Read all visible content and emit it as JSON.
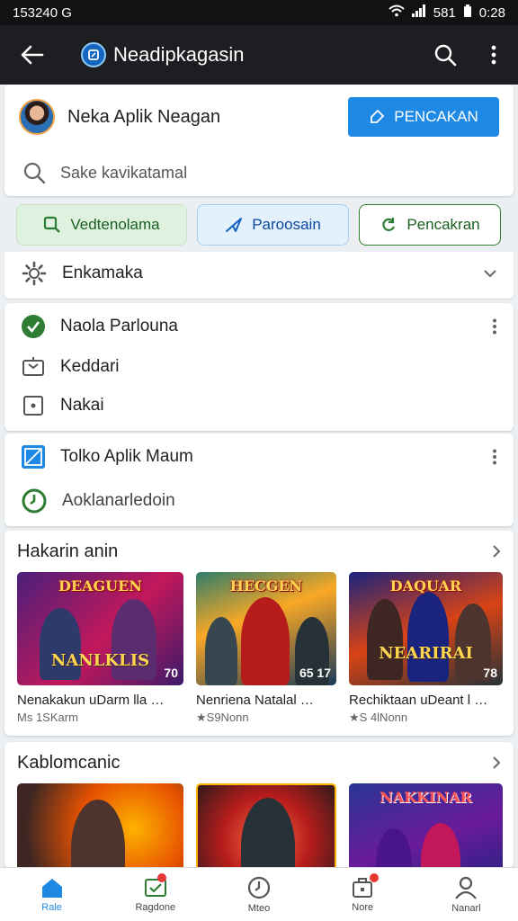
{
  "status_bar": {
    "time_left": "153240 G",
    "clock": "0:28",
    "signal_text": "581"
  },
  "app_bar": {
    "title": "Neadipkagasin"
  },
  "profile": {
    "name": "Neka Aplik Neagan",
    "action_label": "PENCAKAN"
  },
  "search": {
    "placeholder": "Sake kavikatamal"
  },
  "chips": [
    {
      "label": "Vedtenolama"
    },
    {
      "label": "Paroosain"
    },
    {
      "label": "Pencakran"
    }
  ],
  "settings_row": {
    "label": "Enkamaka"
  },
  "list1": [
    {
      "label": "Naola Parlouna"
    },
    {
      "label": "Keddari"
    },
    {
      "label": "Nakai"
    }
  ],
  "list2": [
    {
      "label": "Tolko Aplik Maum"
    },
    {
      "label": "Aoklanarledoin"
    }
  ],
  "section1": {
    "title": "Hakarin anin",
    "items": [
      {
        "art_top": "DEAGUEN",
        "art_bottom": "NANLKLIS",
        "num": "70",
        "title": "Nenakakun uDarm lla",
        "sub": "Ms 1SKarm"
      },
      {
        "art_top": "HECGEN",
        "art_bottom": "",
        "num": "65 17",
        "title": "Nenriena Natalal",
        "sub": "S9Nonn"
      },
      {
        "art_top": "DAQUAR",
        "art_bottom": "NEARIRAI",
        "num": "78",
        "title": "Rechiktaan uDeant l",
        "sub": "S 4lNonn"
      }
    ]
  },
  "section2": {
    "title": "Kablomcanic",
    "items": [
      {
        "art_top": ""
      },
      {
        "art_top": ""
      },
      {
        "art_top": "NAKKINAR"
      }
    ]
  },
  "bottom_nav": [
    {
      "label": "Rale"
    },
    {
      "label": "Ragdone"
    },
    {
      "label": "Mteo"
    },
    {
      "label": "Nore"
    },
    {
      "label": "Nanarl"
    }
  ],
  "colors": {
    "accent": "#1e88e5",
    "green": "#2e7d32",
    "appbar": "#1c1e21"
  }
}
